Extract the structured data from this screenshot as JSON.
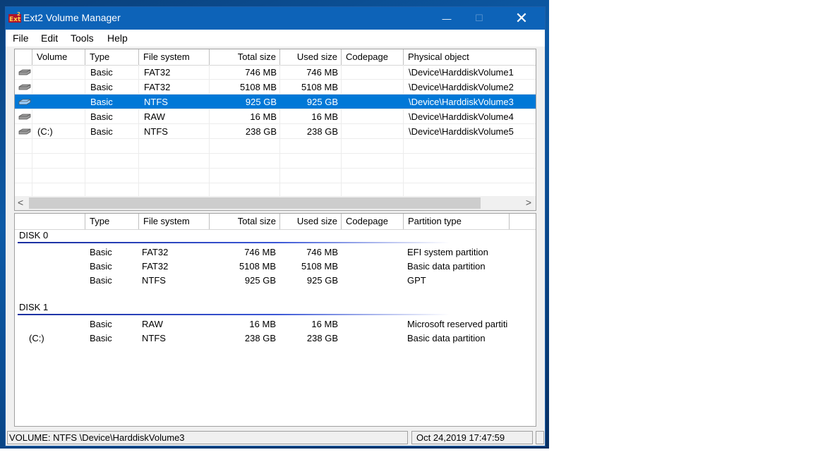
{
  "window": {
    "title": "Ext2 Volume Manager",
    "controls": {
      "minimize": "—",
      "maximize": "☐",
      "close": "✕"
    }
  },
  "menu": [
    "File",
    "Edit",
    "Tools",
    "Help"
  ],
  "volumes": {
    "columns": [
      "",
      "Volume",
      "Type",
      "File system",
      "Total size",
      "Used size",
      "Codepage",
      "Physical object"
    ],
    "rows": [
      {
        "volume": "",
        "type": "Basic",
        "fs": "FAT32",
        "total": "746 MB",
        "used": "746 MB",
        "codepage": "",
        "object": "\\Device\\HarddiskVolume1",
        "icon": "drive-icon",
        "selected": false
      },
      {
        "volume": "",
        "type": "Basic",
        "fs": "FAT32",
        "total": "5108 MB",
        "used": "5108 MB",
        "codepage": "",
        "object": "\\Device\\HarddiskVolume2",
        "icon": "drive-icon",
        "selected": false
      },
      {
        "volume": "",
        "type": "Basic",
        "fs": "NTFS",
        "total": "925 GB",
        "used": "925 GB",
        "codepage": "",
        "object": "\\Device\\HarddiskVolume3",
        "icon": "drive-icon",
        "selected": true
      },
      {
        "volume": "",
        "type": "Basic",
        "fs": "RAW",
        "total": "16 MB",
        "used": "16 MB",
        "codepage": "",
        "object": "\\Device\\HarddiskVolume4",
        "icon": "drive-icon",
        "selected": false
      },
      {
        "volume": "(C:)",
        "type": "Basic",
        "fs": "NTFS",
        "total": "238 GB",
        "used": "238 GB",
        "codepage": "",
        "object": "\\Device\\HarddiskVolume5",
        "icon": "drive-icon",
        "selected": false
      }
    ],
    "scroll_left": "<",
    "scroll_right": ">"
  },
  "partitions": {
    "columns": [
      "",
      "Type",
      "File system",
      "Total size",
      "Used size",
      "Codepage",
      "Partition type",
      ""
    ],
    "disks": [
      {
        "label": "DISK 0",
        "rows": [
          {
            "volume": "",
            "type": "Basic",
            "fs": "FAT32",
            "total": "746 MB",
            "used": "746 MB",
            "codepage": "",
            "ptype": "EFI system partition"
          },
          {
            "volume": "",
            "type": "Basic",
            "fs": "FAT32",
            "total": "5108 MB",
            "used": "5108 MB",
            "codepage": "",
            "ptype": "Basic data partition"
          },
          {
            "volume": "",
            "type": "Basic",
            "fs": "NTFS",
            "total": "925 GB",
            "used": "925 GB",
            "codepage": "",
            "ptype": "GPT"
          }
        ]
      },
      {
        "label": "DISK 1",
        "rows": [
          {
            "volume": "",
            "type": "Basic",
            "fs": "RAW",
            "total": "16 MB",
            "used": "16 MB",
            "codepage": "",
            "ptype": "Microsoft reserved partiti"
          },
          {
            "volume": "(C:)",
            "type": "Basic",
            "fs": "NTFS",
            "total": "238 GB",
            "used": "238 GB",
            "codepage": "",
            "ptype": "Basic data partition"
          }
        ]
      }
    ]
  },
  "status": {
    "left": "VOLUME:  NTFS \\Device\\HarddiskVolume3",
    "right": "Oct 24,2019 17:47:59"
  },
  "colors": {
    "selection": "#0078d7",
    "titlebar": "#0d63b8",
    "accent": "#1a2fa0"
  }
}
